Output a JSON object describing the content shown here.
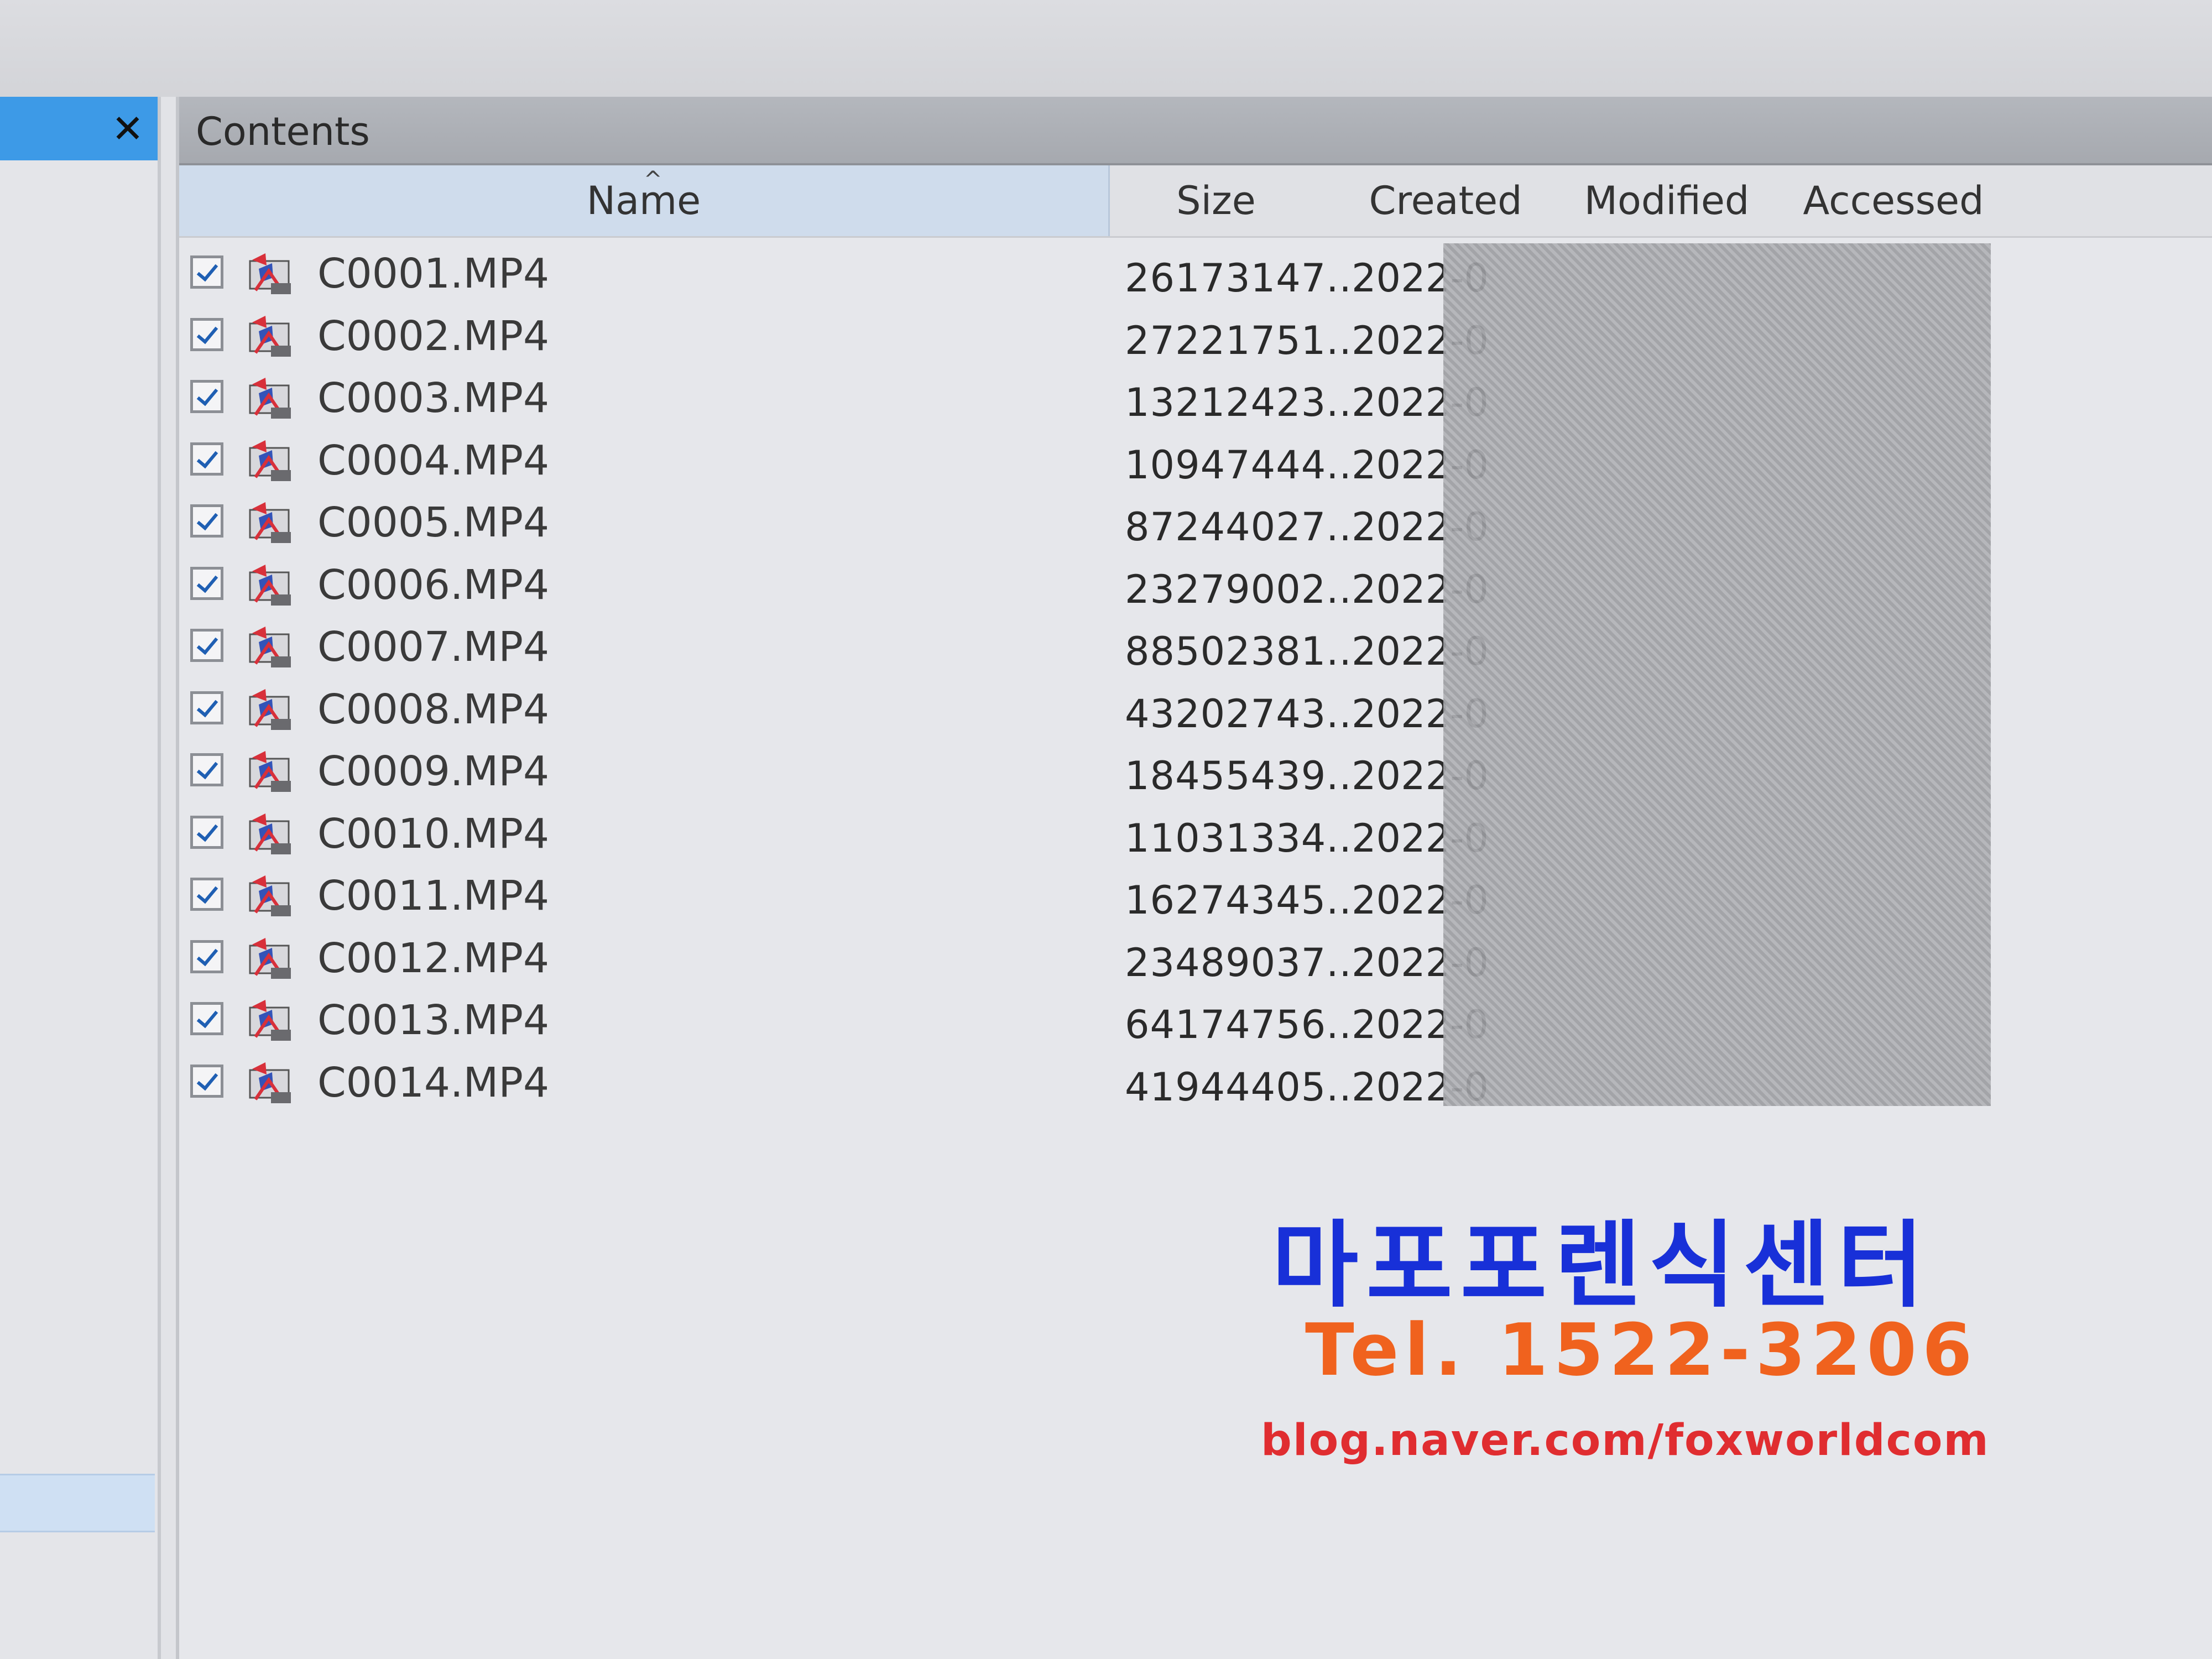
{
  "left_pane": {
    "close_label": "✕"
  },
  "contents": {
    "title": "Contents",
    "columns": {
      "name": "Name",
      "size": "Size",
      "created": "Created",
      "modified": "Modified",
      "accessed": "Accessed"
    },
    "rows": [
      {
        "name": "C0001.MP4",
        "size": "26173147...",
        "created": "2022-0"
      },
      {
        "name": "C0002.MP4",
        "size": "27221751...",
        "created": "2022-0"
      },
      {
        "name": "C0003.MP4",
        "size": "13212423...",
        "created": "2022-0"
      },
      {
        "name": "C0004.MP4",
        "size": "10947444...",
        "created": "2022-0"
      },
      {
        "name": "C0005.MP4",
        "size": "87244027...",
        "created": "2022-0"
      },
      {
        "name": "C0006.MP4",
        "size": "23279002...",
        "created": "2022-0"
      },
      {
        "name": "C0007.MP4",
        "size": "88502381...",
        "created": "2022-0"
      },
      {
        "name": "C0008.MP4",
        "size": "43202743...",
        "created": "2022-0"
      },
      {
        "name": "C0009.MP4",
        "size": "18455439...",
        "created": "2022-0"
      },
      {
        "name": "C0010.MP4",
        "size": "11031334...",
        "created": "2022-0"
      },
      {
        "name": "C0011.MP4",
        "size": "16274345...",
        "created": "2022-0"
      },
      {
        "name": "C0012.MP4",
        "size": "23489037...",
        "created": "2022-0"
      },
      {
        "name": "C0013.MP4",
        "size": "64174756...",
        "created": "2022-0"
      },
      {
        "name": "C0014.MP4",
        "size": "41944405...",
        "created": "2022-0"
      }
    ]
  },
  "watermark": {
    "name": "마포포렌식센터",
    "tel": "Tel. 1522-3206",
    "blog": "blog.naver.com/foxworldcom"
  },
  "colors": {
    "left_header": "#3d9ae7",
    "watermark_name": "#1830d8",
    "watermark_tel": "#f0621e",
    "watermark_blog": "#e02d30"
  },
  "icons": {
    "row_checkbox": "checked-checkbox-icon",
    "row_file": "video-file-icon",
    "left_close": "close-icon"
  }
}
